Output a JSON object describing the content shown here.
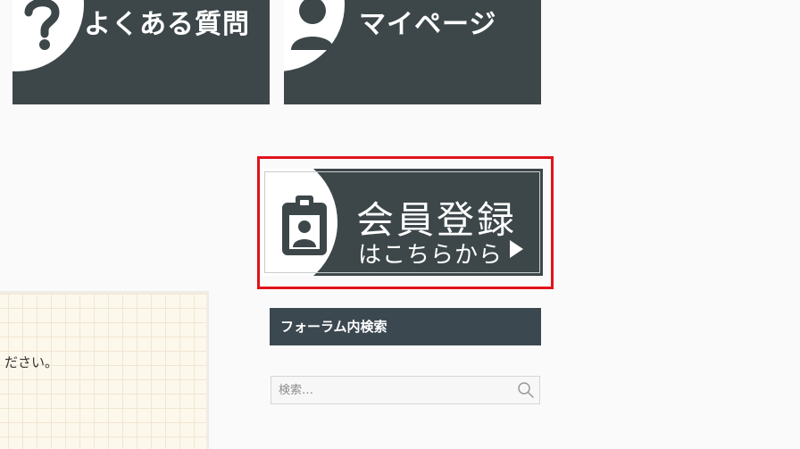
{
  "tiles": {
    "faq": {
      "label": "よくある質問",
      "icon": "question-mark-icon"
    },
    "mypage": {
      "label": "マイページ",
      "icon": "user-silhouette-icon"
    }
  },
  "registration_banner": {
    "title": "会員登録",
    "subtitle": "はこちらから",
    "icon": "id-badge-icon",
    "arrow_icon": "play-triangle-icon",
    "highlight_color": "#e0131b"
  },
  "forum_search": {
    "title": "フォーラム内検索",
    "placeholder": "検索…",
    "button_icon": "search-icon"
  },
  "content_box": {
    "text": "ださい。"
  },
  "colors": {
    "tile_bg": "#3d474a",
    "widget_header_bg": "#3b4850",
    "grid_paper_bg": "#fdf8ec"
  }
}
